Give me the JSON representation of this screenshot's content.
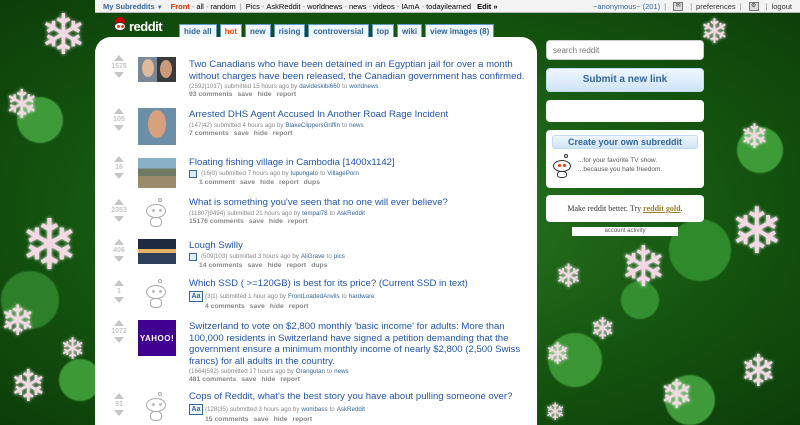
{
  "topbar": {
    "my_subreddits": "My Subreddits",
    "links": [
      "Front",
      "all",
      "random",
      "Pics",
      "AskReddit",
      "worldnews",
      "news",
      "videos",
      "IAmA",
      "todayilearned"
    ],
    "edit": "Edit »",
    "user": "~anonymous~ (201)",
    "preferences": "preferences",
    "logout": "logout"
  },
  "header": {
    "logo_text": "reddit",
    "tabs": [
      "hide all",
      "hot",
      "new",
      "rising",
      "controversial",
      "top",
      "wiki",
      "view images (8)"
    ]
  },
  "posts": [
    {
      "score": "1575",
      "title": "Two Canadians who have been detained in an Egyptian jail for over a month without charges have been released, the Canadian government has confirmed.",
      "tagline_votes": "(2592|1017)",
      "tagline_time": "submitted 15 hours ago by",
      "author": "davideskibi660",
      "to": "to",
      "subreddit": "worldnews",
      "comments": "93 comments",
      "actions": [
        "save",
        "hide",
        "report"
      ]
    },
    {
      "score": "105",
      "title": "Arrested DHS Agent Accused In Another Road Rage Incident",
      "tagline_votes": "(147|42)",
      "tagline_time": "submitted 4 hours ago by",
      "author": "BlakeClippersGriffin",
      "to": "to",
      "subreddit": "news",
      "comments": "7 comments",
      "actions": [
        "save",
        "hide",
        "report"
      ]
    },
    {
      "score": "16",
      "title": "Floating fishing village in Cambodia [1400x1142]",
      "tagline_votes": "(16|0)",
      "tagline_time": "submitted 7 hours ago by",
      "author": "tupungato",
      "to": "to",
      "subreddit": "VillagePorn",
      "comments": "1 comment",
      "actions": [
        "save",
        "hide",
        "report",
        "dups"
      ]
    },
    {
      "score": "2353",
      "title": "What is something you've seen that no one will ever believe?",
      "tagline_votes": "(11807|9494)",
      "tagline_time": "submitted 21 hours ago by",
      "author": "tempal78",
      "to": "to",
      "subreddit": "AskReddit",
      "comments": "15176 comments",
      "actions": [
        "save",
        "hide",
        "report"
      ]
    },
    {
      "score": "406",
      "title": "Lough Swilly",
      "tagline_votes": "(509|103)",
      "tagline_time": "submitted 3 hours ago by",
      "author": "AliGrave",
      "to": "to",
      "subreddit": "pics",
      "comments": "14 comments",
      "actions": [
        "save",
        "hide",
        "report",
        "dups"
      ]
    },
    {
      "score": "1",
      "title": "Which SSD ( >=120GB) is best for its price? (Current SSD in text)",
      "tagline_votes": "(3|1)",
      "tagline_time": "submitted 1 hour ago by",
      "author": "FrontLoadedAnvils",
      "to": "to",
      "subreddit": "hardware",
      "comments": "4 comments",
      "actions": [
        "save",
        "hide",
        "report"
      ]
    },
    {
      "score": "1072",
      "title": "Switzerland to vote on $2,800 monthly 'basic income' for adults: More than 100,000 residents in Switzerland have signed a petition demanding that the government ensure a minimum monthly income of nearly $2,800 (2,500 Swiss francs) for all adults in the country.",
      "thumb_label": "YAHOO!",
      "tagline_votes": "(1664|592)",
      "tagline_time": "submitted 17 hours ago by",
      "author": "Orangutan",
      "to": "to",
      "subreddit": "news",
      "comments": "481 comments",
      "actions": [
        "save",
        "hide",
        "report"
      ]
    },
    {
      "score": "91",
      "title": "Cops of Reddit, what's the best story you have about pulling someone over?",
      "tagline_votes": "(128|35)",
      "tagline_time": "submitted 3 hours ago by",
      "author": "wombass",
      "to": "to",
      "subreddit": "AskReddit",
      "comments": "15 comments",
      "actions": [
        "save",
        "hide",
        "report"
      ]
    }
  ],
  "self_thumb_label": "Aa",
  "sidebar": {
    "search_placeholder": "search reddit",
    "submit_label": "Submit a new link",
    "create_label": "Create your own subreddit",
    "create_line1": "...for your favorite TV show.",
    "create_line2": "...because you hate freedom.",
    "gold_prefix": "Make reddit better. Try ",
    "gold_link": "reddit gold",
    "gold_suffix": ".",
    "account_activity": "account activity"
  },
  "colors": {
    "link": "#2255aa",
    "tab_border": "#5f99cf",
    "selected_tab": "#ff4500",
    "background_green": "#14540f"
  }
}
